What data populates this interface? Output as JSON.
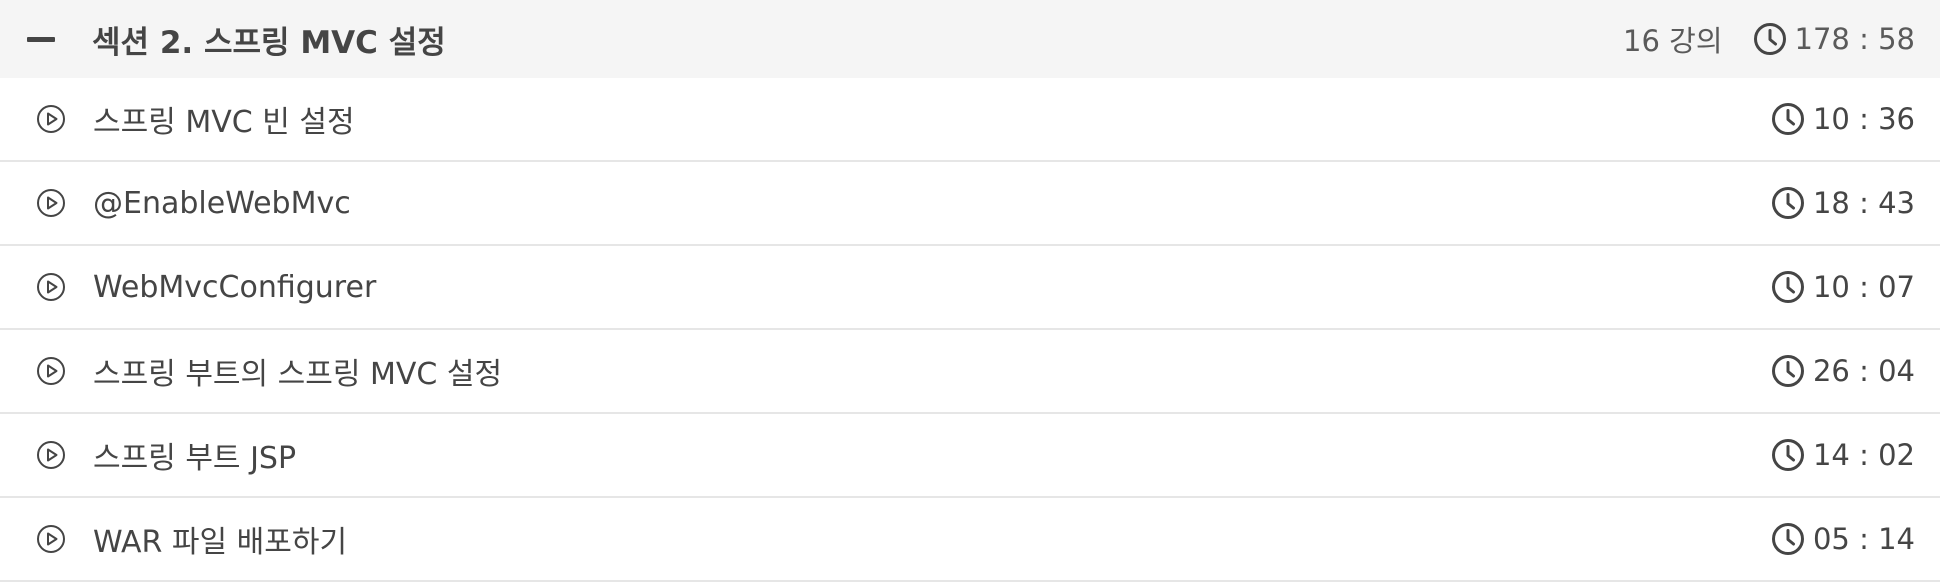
{
  "section": {
    "title": "섹션 2. 스프링 MVC 설정",
    "lecture_count": "16 강의",
    "total_duration": "178 : 58",
    "collapse_icon": "minus-icon"
  },
  "lectures": [
    {
      "title": "스프링 MVC 빈 설정",
      "duration": "10 : 36",
      "icon": "play-circle-icon"
    },
    {
      "title": "@EnableWebMvc",
      "duration": "18 : 43",
      "icon": "play-circle-icon"
    },
    {
      "title": "WebMvcConfigurer",
      "duration": "10 : 07",
      "icon": "play-circle-icon"
    },
    {
      "title": "스프링 부트의 스프링 MVC 설정",
      "duration": "26 : 04",
      "icon": "play-circle-icon"
    },
    {
      "title": "스프링 부트 JSP",
      "duration": "14 : 02",
      "icon": "play-circle-icon"
    },
    {
      "title": "WAR 파일 배포하기",
      "duration": "05 : 14",
      "icon": "play-circle-icon"
    }
  ],
  "colors": {
    "header_bg": "#f5f5f5",
    "text": "#454545",
    "divider": "#e6e6e6"
  }
}
